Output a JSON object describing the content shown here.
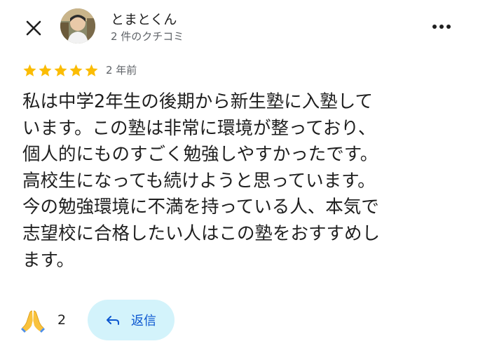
{
  "header": {
    "reviewer_name": "とまとくん",
    "review_count": "2 件のクチコミ"
  },
  "rating": {
    "stars": 5,
    "max_stars": 5,
    "star_color": "#fbbc04",
    "date": "2 年前"
  },
  "review": {
    "lines": [
      "私は中学2年生の後期から新生塾に入塾して",
      "います。この塾は非常に環境が整っており、",
      "個人的にものすごく勉強しやすかったです。",
      "高校生になっても続けようと思っています。",
      "今の勉強環境に不満を持っている人、本気で",
      "志望校に合格したい人はこの塾をおすすめし",
      "ます。"
    ]
  },
  "footer": {
    "reaction_icon": "folded-hands-emoji",
    "reaction_count": "2",
    "reply_label": "返信",
    "reply_button_color": "#d3f3fb",
    "reply_text_color": "#0b57d0"
  }
}
